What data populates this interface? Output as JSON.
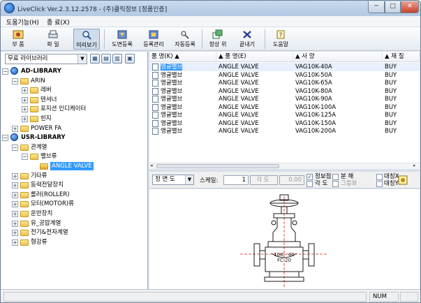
{
  "window": {
    "title": "LiveClick Ver.2.3.12.2578 - (주)클릭정보 [정품인증]",
    "min": "─",
    "max": "□",
    "close": "✕"
  },
  "menu": [
    {
      "label": "도움기능(H)"
    },
    {
      "label": "종 료(X)"
    }
  ],
  "toolbar": [
    {
      "label": "부 품",
      "icon": "parts-icon"
    },
    {
      "label": "파 일",
      "icon": "printer-icon"
    },
    {
      "label": "미리보기",
      "icon": "magnifier-icon",
      "active": true
    },
    {
      "label": "도면등록",
      "icon": "drawing-register-icon"
    },
    {
      "label": "등록관리",
      "icon": "register-manage-icon"
    },
    {
      "label": "자동등록",
      "icon": "auto-register-icon"
    },
    {
      "label": "항상 위",
      "icon": "always-on-top-icon"
    },
    {
      "label": "끝내기",
      "icon": "exit-icon"
    },
    {
      "label": "도움말",
      "icon": "help-icon"
    }
  ],
  "library": {
    "selected": "무료 라이브러리"
  },
  "tree": [
    {
      "label": "AD-LIBRARY",
      "level": 0,
      "expanded": true,
      "kind": "root"
    },
    {
      "label": "ARIN",
      "level": 1,
      "expanded": true,
      "kind": "folder"
    },
    {
      "label": "레버",
      "level": 2,
      "expanded": false,
      "kind": "folder"
    },
    {
      "label": "텐셔너",
      "level": 2,
      "expanded": false,
      "kind": "folder"
    },
    {
      "label": "포지션 인디케이터",
      "level": 2,
      "expanded": false,
      "kind": "folder"
    },
    {
      "label": "힌지",
      "level": 2,
      "expanded": false,
      "kind": "folder"
    },
    {
      "label": "POWER FA",
      "level": 1,
      "expanded": false,
      "kind": "folder"
    },
    {
      "label": "USR-LIBRARY",
      "level": 0,
      "expanded": true,
      "kind": "root"
    },
    {
      "label": "관계열",
      "level": 1,
      "expanded": true,
      "kind": "folder"
    },
    {
      "label": "밸브류",
      "level": 2,
      "expanded": true,
      "kind": "folder"
    },
    {
      "label": "ANGLE VALVE",
      "level": 3,
      "expanded": null,
      "kind": "item",
      "selected": true
    },
    {
      "label": "기타류",
      "level": 1,
      "expanded": false,
      "kind": "folder"
    },
    {
      "label": "동력전달장치",
      "level": 1,
      "expanded": false,
      "kind": "folder"
    },
    {
      "label": "롤러(ROLLER)",
      "level": 1,
      "expanded": false,
      "kind": "folder"
    },
    {
      "label": "모터(MOTOR)류",
      "level": 1,
      "expanded": false,
      "kind": "folder"
    },
    {
      "label": "운반장치",
      "level": 1,
      "expanded": false,
      "kind": "folder"
    },
    {
      "label": "유_공압계열",
      "level": 1,
      "expanded": false,
      "kind": "folder"
    },
    {
      "label": "전기&전자계열",
      "level": 1,
      "expanded": false,
      "kind": "folder"
    },
    {
      "label": "형강류",
      "level": 1,
      "expanded": false,
      "kind": "folder"
    }
  ],
  "table": {
    "headers": [
      "품 명(K) ▲",
      "▲ 품 명(E)",
      "▲ 사 양",
      "▲ 재 질"
    ],
    "rows": [
      [
        "앵글밸브",
        "ANGLE VALVE",
        "VAG10K-40A",
        "BUY"
      ],
      [
        "앵글밸브",
        "ANGLE VALVE",
        "VAG10K-50A",
        "BUY"
      ],
      [
        "앵글밸브",
        "ANGLE VALVE",
        "VAG10K-65A",
        "BUY"
      ],
      [
        "앵글밸브",
        "ANGLE VALVE",
        "VAG10K-80A",
        "BUY"
      ],
      [
        "앵글밸브",
        "ANGLE VALVE",
        "VAG10K-90A",
        "BUY"
      ],
      [
        "앵글밸브",
        "ANGLE VALVE",
        "VAG10K-100A",
        "BUY"
      ],
      [
        "앵글밸브",
        "ANGLE VALVE",
        "VAG10K-125A",
        "BUY"
      ],
      [
        "앵글밸브",
        "ANGLE VALVE",
        "VAG10K-150A",
        "BUY"
      ],
      [
        "앵글밸브",
        "ANGLE VALVE",
        "VAG10K-200A",
        "BUY"
      ]
    ]
  },
  "viewbar": {
    "view": "정 면 도",
    "scale_label": "스케일:",
    "scale_value": "1",
    "angle_placeholder": "각 도",
    "angle_value": "0.00",
    "checks": [
      {
        "label": "정보점",
        "checked": true,
        "disabled": false
      },
      {
        "label": "각 도",
        "checked": false,
        "disabled": false
      },
      {
        "label": "분 해",
        "checked": false,
        "disabled": false
      },
      {
        "label": "그룹화",
        "checked": false,
        "disabled": true
      },
      {
        "label": "대칭X",
        "checked": false,
        "disabled": false
      },
      {
        "label": "대칭Y",
        "checked": false,
        "disabled": false
      }
    ]
  },
  "preview": {
    "label_line1": "10K - 40",
    "label_line2": "FC 20"
  },
  "status": {
    "num": "NUM"
  },
  "colors": {
    "accent": "#3399ff",
    "title_bar": "#b3c8e2",
    "drawing_red": "#d81c1c"
  }
}
